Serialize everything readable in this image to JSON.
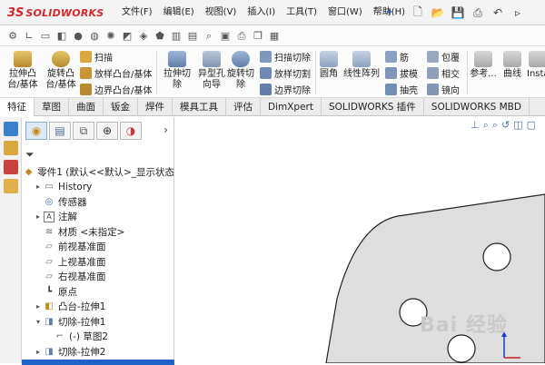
{
  "app": {
    "brand_ds": "3S",
    "brand_name": "SOLIDWORKS"
  },
  "menu": [
    "文件(F)",
    "编辑(E)",
    "视图(V)",
    "插入(I)",
    "工具(T)",
    "窗口(W)",
    "帮助(H)"
  ],
  "ribbon": {
    "extrude_boss": "拉伸凸\n台/基体",
    "revolve_boss": "旋转凸\n台/基体",
    "sweep": "扫描",
    "loft_boss": "放样凸台/基体",
    "boundary_boss": "边界凸台/基体",
    "extrude_cut": "拉伸切\n除",
    "hole_wizard": "异型孔\n向导",
    "revolve_cut": "旋转切\n除",
    "sweep_cut": "扫描切除",
    "loft_cut": "放样切割",
    "boundary_cut": "边界切除",
    "fillet": "圆角",
    "linear_pattern": "线性阵列",
    "rib": "筋",
    "draft": "拔模",
    "shell": "抽壳",
    "wrap": "包覆",
    "intersect": "相交",
    "mirror": "镜向",
    "reference": "参考...",
    "curves": "曲线",
    "instant3d": "Insta"
  },
  "tabs": [
    "特征",
    "草图",
    "曲面",
    "钣金",
    "焊件",
    "模具工具",
    "评估",
    "DimXpert",
    "SOLIDWORKS 插件",
    "SOLIDWORKS MBD"
  ],
  "tree": {
    "root": "零件1 (默认<<默认>_显示状态",
    "items": [
      {
        "label": "History",
        "arrow": "▸",
        "indent": 1
      },
      {
        "label": "传感器",
        "arrow": "",
        "indent": 1
      },
      {
        "label": "注解",
        "arrow": "▸",
        "indent": 1
      },
      {
        "label": "材质 <未指定>",
        "arrow": "",
        "indent": 1
      },
      {
        "label": "前视基准面",
        "arrow": "",
        "indent": 1
      },
      {
        "label": "上视基准面",
        "arrow": "",
        "indent": 1
      },
      {
        "label": "右视基准面",
        "arrow": "",
        "indent": 1
      },
      {
        "label": "原点",
        "arrow": "",
        "indent": 1
      },
      {
        "label": "凸台-拉伸1",
        "arrow": "▸",
        "indent": 1
      },
      {
        "label": "切除-拉伸1",
        "arrow": "▾",
        "indent": 1
      },
      {
        "label": "(-) 草图2",
        "arrow": "",
        "indent": 2
      },
      {
        "label": "切除-拉伸2",
        "arrow": "▸",
        "indent": 1
      }
    ]
  },
  "watermark": "Bai 经验",
  "colors": {
    "brand": "#d8262c",
    "selection": "#1e64c8"
  }
}
